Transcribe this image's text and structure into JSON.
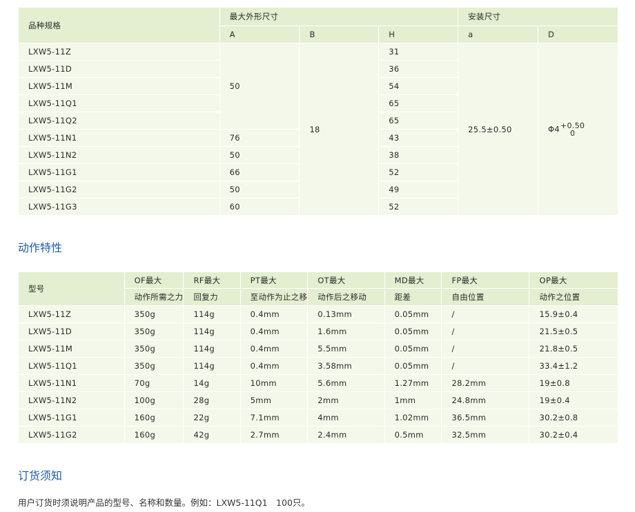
{
  "spec": {
    "col_model": "品种规格",
    "group_max": "最大外形尺寸",
    "group_install": "安装尺寸",
    "cols": [
      "A",
      "B",
      "H",
      "a",
      "D"
    ],
    "models": [
      "LXW5-11Z",
      "LXW5-11D",
      "LXW5-11M",
      "LXW5-11Q1",
      "LXW5-11Q2",
      "LXW5-11N1",
      "LXW5-11N2",
      "LXW5-11G1",
      "LXW5-11G2",
      "LXW5-11G3"
    ],
    "A_merged": "50",
    "A": [
      "76",
      "50",
      "66",
      "50",
      "60"
    ],
    "B": "18",
    "H": [
      "31",
      "36",
      "54",
      "65",
      "65",
      "43",
      "38",
      "52",
      "49",
      "52"
    ],
    "a": "25.5±0.50",
    "D_base": "Φ4",
    "D_upper": "+0.50",
    "D_lower": "0"
  },
  "action_title": "动作特性",
  "action": {
    "col_model": "型号",
    "headers": [
      {
        "code": "OF最大",
        "desc": "动作所需之力"
      },
      {
        "code": "RF最大",
        "desc": "回复力"
      },
      {
        "code": "PT最大",
        "desc": "至动作为止之移"
      },
      {
        "code": "OT最大",
        "desc": "动作后之移动"
      },
      {
        "code": "MD最大",
        "desc": "距差"
      },
      {
        "code": "FP最大",
        "desc": "自由位置"
      },
      {
        "code": "OP最大",
        "desc": "动作之位置"
      }
    ],
    "rows": [
      [
        "LXW5-11Z",
        "350g",
        "114g",
        "0.4mm",
        "0.13mm",
        "0.05mm",
        "/",
        "15.9±0.4"
      ],
      [
        "LXW5-11D",
        "350g",
        "114g",
        "0.4mm",
        "1.6mm",
        "0.05mm",
        "/",
        "21.5±0.5"
      ],
      [
        "LXW5-11M",
        "350g",
        "114g",
        "0.4mm",
        "5.5mm",
        "0.05mm",
        "/",
        "21.8±0.5"
      ],
      [
        "LXW5-11Q1",
        "350g",
        "114g",
        "0.4mm",
        "3.58mm",
        "0.05mm",
        "/",
        "33.4±1.2"
      ],
      [
        "LXW5-11N1",
        "70g",
        "14g",
        "10mm",
        "5.6mm",
        "1.27mm",
        "28.2mm",
        "19±0.8"
      ],
      [
        "LXW5-11N2",
        "100g",
        "28g",
        "5mm",
        "2mm",
        "1mm",
        "24.8mm",
        "19±0.4"
      ],
      [
        "LXW5-11G1",
        "160g",
        "22g",
        "7.1mm",
        "4mm",
        "1.02mm",
        "36.5mm",
        "30.2±0.8"
      ],
      [
        "LXW5-11G2",
        "160g",
        "42g",
        "2.7mm",
        "2.4mm",
        "0.5mm",
        "32.5mm",
        "30.2±0.4"
      ]
    ]
  },
  "order_title": "订货须知",
  "order_note": "用户订货时须说明产品的型号、名称和数量。例如：LXW5-11Q1　100只。"
}
